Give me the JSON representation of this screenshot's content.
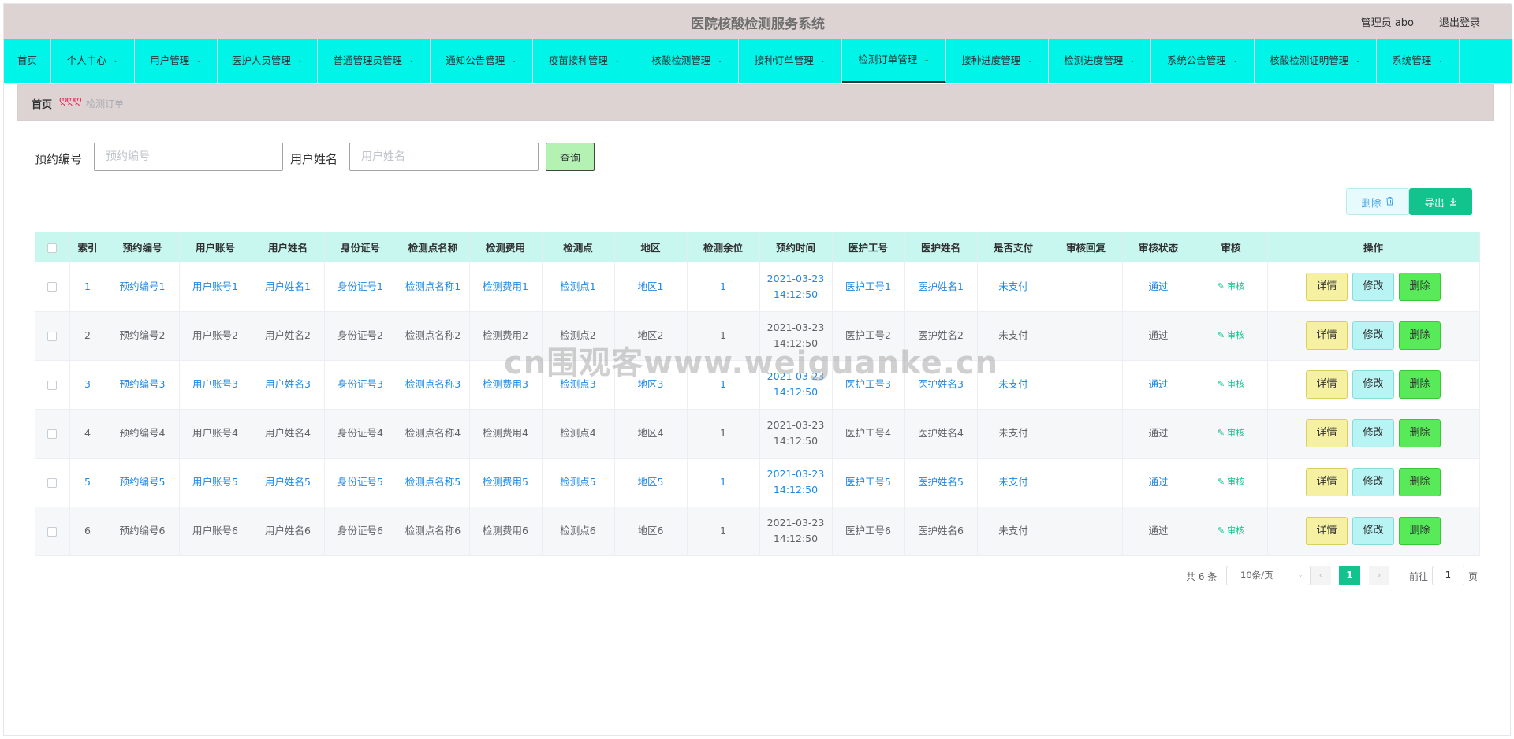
{
  "header": {
    "title": "医院核酸检测服务系统",
    "user": "管理员 abo",
    "logout": "退出登录"
  },
  "nav": [
    {
      "label": "首页",
      "dropdown": false,
      "width": 60
    },
    {
      "label": "个人中心",
      "dropdown": true,
      "width": 106
    },
    {
      "label": "用户管理",
      "dropdown": true,
      "width": 105
    },
    {
      "label": "医护人员管理",
      "dropdown": true,
      "width": 127
    },
    {
      "label": "普通管理员管理",
      "dropdown": true,
      "width": 143
    },
    {
      "label": "通知公告管理",
      "dropdown": true,
      "width": 130
    },
    {
      "label": "疫苗接种管理",
      "dropdown": true,
      "width": 131
    },
    {
      "label": "核酸检测管理",
      "dropdown": true,
      "width": 130
    },
    {
      "label": "接种订单管理",
      "dropdown": true,
      "width": 131
    },
    {
      "label": "检测订单管理",
      "dropdown": true,
      "width": 132,
      "active": true
    },
    {
      "label": "接种进度管理",
      "dropdown": true,
      "width": 130
    },
    {
      "label": "检测进度管理",
      "dropdown": true,
      "width": 130
    },
    {
      "label": "系统公告管理",
      "dropdown": true,
      "width": 131
    },
    {
      "label": "核酸检测证明管理",
      "dropdown": true,
      "width": 155
    },
    {
      "label": "系统管理",
      "dropdown": true,
      "width": 105
    }
  ],
  "breadcrumb": {
    "home": "首页",
    "separator": "ღღღ",
    "current": "检测订单"
  },
  "search": {
    "label1": "预约编号",
    "placeholder1": "预约编号",
    "label2": "用户姓名",
    "placeholder2": "用户姓名",
    "query": "查询"
  },
  "toolbar": {
    "delete": "删除",
    "export": "导出"
  },
  "table": {
    "columns": [
      "索引",
      "预约编号",
      "用户账号",
      "用户姓名",
      "身份证号",
      "检测点名称",
      "检测费用",
      "检测点",
      "地区",
      "检测余位",
      "预约时间",
      "医护工号",
      "医护姓名",
      "是否支付",
      "审核回复",
      "审核状态",
      "审核",
      "操作"
    ],
    "rows": [
      {
        "index": "1",
        "booking_no": "预约编号1",
        "account": "用户账号1",
        "name": "用户姓名1",
        "id_no": "身份证号1",
        "site_name": "检测点名称1",
        "fee": "检测费用1",
        "site": "检测点1",
        "region": "地区1",
        "remaining": "1",
        "date": "2021-03-23",
        "time": "14:12:50",
        "staff_no": "医护工号1",
        "staff_name": "医护姓名1",
        "paid": "未支付",
        "reply": "",
        "status": "通过"
      },
      {
        "index": "2",
        "booking_no": "预约编号2",
        "account": "用户账号2",
        "name": "用户姓名2",
        "id_no": "身份证号2",
        "site_name": "检测点名称2",
        "fee": "检测费用2",
        "site": "检测点2",
        "region": "地区2",
        "remaining": "1",
        "date": "2021-03-23",
        "time": "14:12:50",
        "staff_no": "医护工号2",
        "staff_name": "医护姓名2",
        "paid": "未支付",
        "reply": "",
        "status": "通过"
      },
      {
        "index": "3",
        "booking_no": "预约编号3",
        "account": "用户账号3",
        "name": "用户姓名3",
        "id_no": "身份证号3",
        "site_name": "检测点名称3",
        "fee": "检测费用3",
        "site": "检测点3",
        "region": "地区3",
        "remaining": "1",
        "date": "2021-03-23",
        "time": "14:12:50",
        "staff_no": "医护工号3",
        "staff_name": "医护姓名3",
        "paid": "未支付",
        "reply": "",
        "status": "通过"
      },
      {
        "index": "4",
        "booking_no": "预约编号4",
        "account": "用户账号4",
        "name": "用户姓名4",
        "id_no": "身份证号4",
        "site_name": "检测点名称4",
        "fee": "检测费用4",
        "site": "检测点4",
        "region": "地区4",
        "remaining": "1",
        "date": "2021-03-23",
        "time": "14:12:50",
        "staff_no": "医护工号4",
        "staff_name": "医护姓名4",
        "paid": "未支付",
        "reply": "",
        "status": "通过"
      },
      {
        "index": "5",
        "booking_no": "预约编号5",
        "account": "用户账号5",
        "name": "用户姓名5",
        "id_no": "身份证号5",
        "site_name": "检测点名称5",
        "fee": "检测费用5",
        "site": "检测点5",
        "region": "地区5",
        "remaining": "1",
        "date": "2021-03-23",
        "time": "14:12:50",
        "staff_no": "医护工号5",
        "staff_name": "医护姓名5",
        "paid": "未支付",
        "reply": "",
        "status": "通过"
      },
      {
        "index": "6",
        "booking_no": "预约编号6",
        "account": "用户账号6",
        "name": "用户姓名6",
        "id_no": "身份证号6",
        "site_name": "检测点名称6",
        "fee": "检测费用6",
        "site": "检测点6",
        "region": "地区6",
        "remaining": "1",
        "date": "2021-03-23",
        "time": "14:12:50",
        "staff_no": "医护工号6",
        "staff_name": "医护姓名6",
        "paid": "未支付",
        "reply": "",
        "status": "通过"
      }
    ],
    "audit_label": "审核",
    "actions": {
      "detail": "详情",
      "edit": "修改",
      "delete": "删除"
    }
  },
  "pagination": {
    "total": "共 6 条",
    "page_size": "10条/页",
    "current_page": "1",
    "goto_label": "前往",
    "goto_value": "1",
    "goto_unit": "页"
  },
  "watermark": "cn围观客www.weiguanke.cn",
  "colors": {
    "nav_bg": "#00f5e8",
    "header_bg": "#ddd3d3",
    "accent": "#13c38e",
    "link": "#1e88e5"
  }
}
